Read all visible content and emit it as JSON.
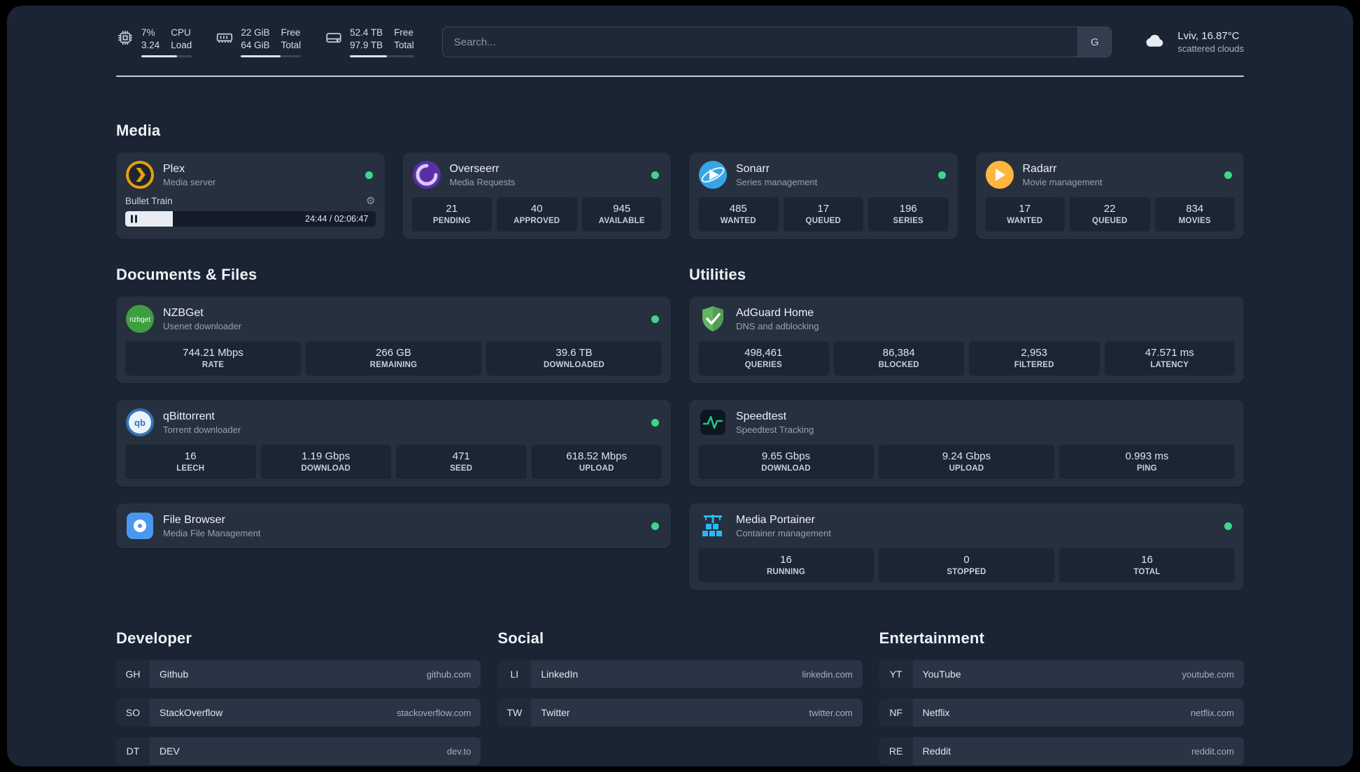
{
  "topbar": {
    "resources": [
      {
        "icon": "cpu-icon",
        "line1": "7%",
        "line2": "3.24",
        "label1": "CPU",
        "label2": "Load",
        "progress": 70
      },
      {
        "icon": "memory-icon",
        "line1": "22 GiB",
        "line2": "64 GiB",
        "label1": "Free",
        "label2": "Total",
        "progress": 66
      },
      {
        "icon": "disk-icon",
        "line1": "52.4 TB",
        "line2": "97.9 TB",
        "label1": "Free",
        "label2": "Total",
        "progress": 58
      }
    ],
    "search": {
      "placeholder": "Search...",
      "button": "G"
    },
    "weather": {
      "location": "Lviv, 16.87°C",
      "condition": "scattered clouds"
    }
  },
  "sections": {
    "media": {
      "title": "Media",
      "plex": {
        "name": "Plex",
        "desc": "Media server",
        "icon": "plex-icon",
        "status": "online",
        "now_playing": {
          "title": "Bullet Train",
          "time": "24:44 / 02:06:47",
          "progress": 19
        }
      },
      "overseerr": {
        "name": "Overseerr",
        "desc": "Media Requests",
        "icon": "overseerr-icon",
        "status": "online",
        "stats": [
          {
            "value": "21",
            "label": "PENDING"
          },
          {
            "value": "40",
            "label": "APPROVED"
          },
          {
            "value": "945",
            "label": "AVAILABLE"
          }
        ]
      },
      "sonarr": {
        "name": "Sonarr",
        "desc": "Series management",
        "icon": "sonarr-icon",
        "status": "online",
        "stats": [
          {
            "value": "485",
            "label": "WANTED"
          },
          {
            "value": "17",
            "label": "QUEUED"
          },
          {
            "value": "196",
            "label": "SERIES"
          }
        ]
      },
      "radarr": {
        "name": "Radarr",
        "desc": "Movie management",
        "icon": "radarr-icon",
        "status": "online",
        "stats": [
          {
            "value": "17",
            "label": "WANTED"
          },
          {
            "value": "22",
            "label": "QUEUED"
          },
          {
            "value": "834",
            "label": "MOVIES"
          }
        ]
      }
    },
    "documents": {
      "title": "Documents & Files",
      "nzbget": {
        "name": "NZBGet",
        "desc": "Usenet downloader",
        "icon": "nzbget-icon",
        "status": "online",
        "stats": [
          {
            "value": "744.21 Mbps",
            "label": "RATE"
          },
          {
            "value": "266 GB",
            "label": "REMAINING"
          },
          {
            "value": "39.6 TB",
            "label": "DOWNLOADED"
          }
        ]
      },
      "qbittorrent": {
        "name": "qBittorrent",
        "desc": "Torrent downloader",
        "icon": "qbittorrent-icon",
        "status": "online",
        "stats": [
          {
            "value": "16",
            "label": "LEECH"
          },
          {
            "value": "1.19 Gbps",
            "label": "DOWNLOAD"
          },
          {
            "value": "471",
            "label": "SEED"
          },
          {
            "value": "618.52 Mbps",
            "label": "UPLOAD"
          }
        ]
      },
      "filebrowser": {
        "name": "File Browser",
        "desc": "Media File Management",
        "icon": "filebrowser-icon",
        "status": "online"
      }
    },
    "utilities": {
      "title": "Utilities",
      "adguard": {
        "name": "AdGuard Home",
        "desc": "DNS and adblocking",
        "icon": "adguard-icon",
        "stats": [
          {
            "value": "498,461",
            "label": "QUERIES"
          },
          {
            "value": "86,384",
            "label": "BLOCKED"
          },
          {
            "value": "2,953",
            "label": "FILTERED"
          },
          {
            "value": "47.571 ms",
            "label": "LATENCY"
          }
        ]
      },
      "speedtest": {
        "name": "Speedtest",
        "desc": "Speedtest Tracking",
        "icon": "speedtest-icon",
        "stats": [
          {
            "value": "9.65 Gbps",
            "label": "DOWNLOAD"
          },
          {
            "value": "9.24 Gbps",
            "label": "UPLOAD"
          },
          {
            "value": "0.993 ms",
            "label": "PING"
          }
        ]
      },
      "portainer": {
        "name": "Media Portainer",
        "desc": "Container management",
        "icon": "portainer-icon",
        "status": "online",
        "stats": [
          {
            "value": "16",
            "label": "RUNNING"
          },
          {
            "value": "0",
            "label": "STOPPED"
          },
          {
            "value": "16",
            "label": "TOTAL"
          }
        ]
      }
    }
  },
  "bookmarks": {
    "developer": {
      "title": "Developer",
      "items": [
        {
          "abbr": "GH",
          "name": "Github",
          "url": "github.com"
        },
        {
          "abbr": "SO",
          "name": "StackOverflow",
          "url": "stackoverflow.com"
        },
        {
          "abbr": "DT",
          "name": "DEV",
          "url": "dev.to"
        }
      ]
    },
    "social": {
      "title": "Social",
      "items": [
        {
          "abbr": "LI",
          "name": "LinkedIn",
          "url": "linkedin.com"
        },
        {
          "abbr": "TW",
          "name": "Twitter",
          "url": "twitter.com"
        }
      ]
    },
    "entertainment": {
      "title": "Entertainment",
      "items": [
        {
          "abbr": "YT",
          "name": "YouTube",
          "url": "youtube.com"
        },
        {
          "abbr": "NF",
          "name": "Netflix",
          "url": "netflix.com"
        },
        {
          "abbr": "RE",
          "name": "Reddit",
          "url": "reddit.com"
        }
      ]
    }
  },
  "icons": {
    "gear_glyph": "⚙",
    "nzbget_text": "nzbget",
    "qbittorrent_text": "qb"
  },
  "colors": {
    "status_online": "#3dd68c",
    "accent_amber": "#e5a00d"
  }
}
